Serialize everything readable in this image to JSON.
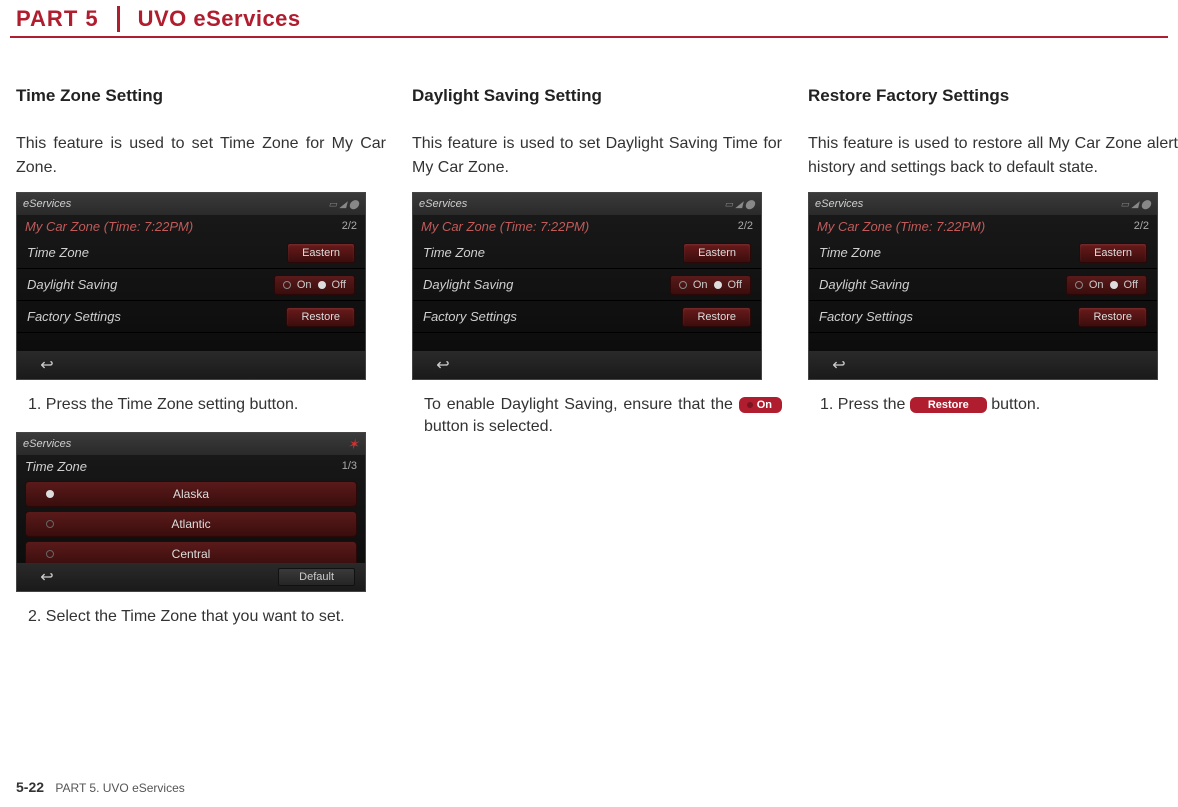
{
  "header": {
    "part": "PART 5",
    "title": "UVO eServices"
  },
  "columns": [
    {
      "title": "Time Zone Setting",
      "intro": "This feature is used to set Time Zone for My Car Zone.",
      "shot": {
        "brand": "eServices",
        "subtitle": "My Car Zone (Time: 7:22PM)",
        "page": "2/2",
        "rows": [
          {
            "label": "Time Zone",
            "btn": "Eastern"
          },
          {
            "label": "Daylight Saving",
            "on": "On",
            "off": "Off"
          },
          {
            "label": "Factory Settings",
            "btn": "Restore"
          }
        ]
      },
      "steps": [
        "1. Press the Time Zone setting button."
      ],
      "tzshot": {
        "brand": "eServices",
        "title": "Time Zone",
        "page": "1/3",
        "items": [
          "Alaska",
          "Atlantic",
          "Central"
        ],
        "default_btn": "Default"
      },
      "step2": "2. Select the Time Zone that you want to set."
    },
    {
      "title": "Daylight Saving Setting",
      "intro": "This feature is used to set Daylight Saving Time for My Car Zone.",
      "shot": {
        "brand": "eServices",
        "subtitle": "My Car Zone (Time: 7:22PM)",
        "page": "2/2",
        "rows": [
          {
            "label": "Time Zone",
            "btn": "Eastern"
          },
          {
            "label": "Daylight Saving",
            "on": "On",
            "off": "Off"
          },
          {
            "label": "Factory Settings",
            "btn": "Restore"
          }
        ]
      },
      "instr_a": "To enable Daylight Saving, ensure that the ",
      "instr_btn": "On",
      "instr_b": " button is selected."
    },
    {
      "title": "Restore Factory Settings",
      "intro": "This feature is used to restore all My Car Zone alert history and settings back to default state.",
      "shot": {
        "brand": "eServices",
        "subtitle": "My Car Zone (Time: 7:22PM)",
        "page": "2/2",
        "rows": [
          {
            "label": "Time Zone",
            "btn": "Eastern"
          },
          {
            "label": "Daylight Saving",
            "on": "On",
            "off": "Off"
          },
          {
            "label": "Factory Settings",
            "btn": "Restore"
          }
        ]
      },
      "step_a": "1. Press the ",
      "step_btn": "Restore",
      "step_b": " button."
    }
  ],
  "footer": {
    "page": "5-22",
    "label": "PART 5. UVO eServices"
  },
  "status_icons": "▭ ◢ ⬤"
}
